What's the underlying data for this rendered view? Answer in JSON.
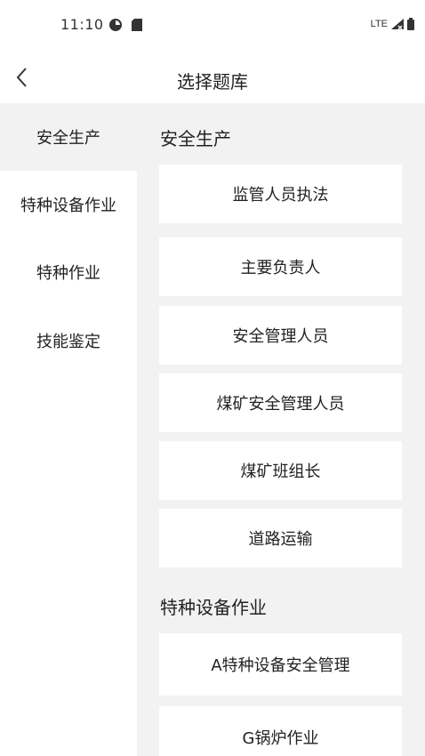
{
  "status_bar": {
    "time": "11:10",
    "network": "LTE"
  },
  "header": {
    "title": "选择题库"
  },
  "sidebar": {
    "items": [
      {
        "label": "安全生产"
      },
      {
        "label": "特种设备作业"
      },
      {
        "label": "特种作业"
      },
      {
        "label": "技能鉴定"
      }
    ]
  },
  "content": {
    "sections": [
      {
        "title": "安全生产",
        "items": [
          "监管人员执法",
          "主要负责人",
          "安全管理人员",
          "煤矿安全管理人员",
          "煤矿班组长",
          "道路运输"
        ]
      },
      {
        "title": "特种设备作业",
        "items": [
          "A特种设备安全管理",
          "G锅炉作业"
        ]
      }
    ]
  }
}
